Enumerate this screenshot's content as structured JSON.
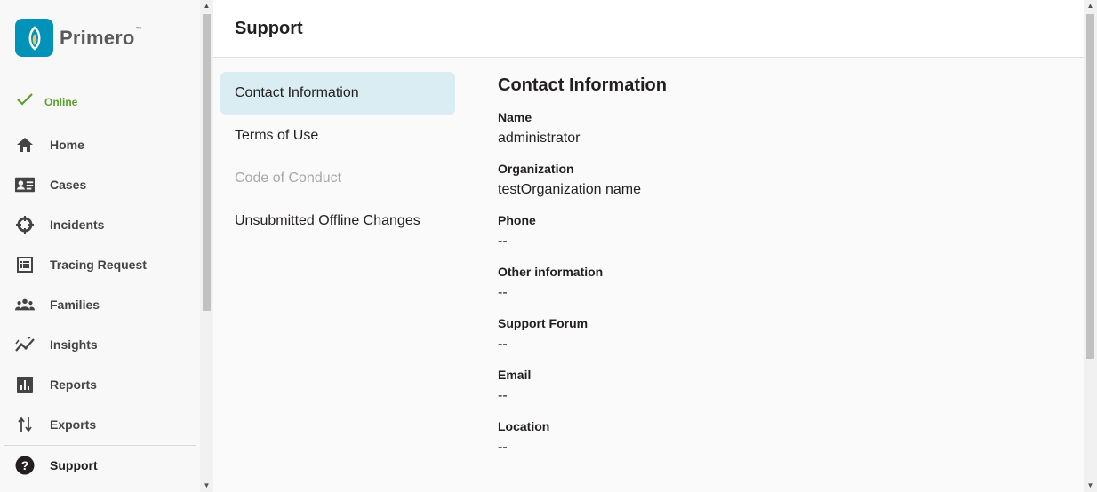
{
  "app": {
    "name": "Primero",
    "trademark": "™"
  },
  "status": {
    "label": "Online",
    "color": "#5aa02c"
  },
  "sidebar": {
    "items": [
      {
        "label": "Home",
        "icon": "home-icon"
      },
      {
        "label": "Cases",
        "icon": "id-card-icon"
      },
      {
        "label": "Incidents",
        "icon": "crosshair-icon"
      },
      {
        "label": "Tracing Request",
        "icon": "list-icon"
      },
      {
        "label": "Families",
        "icon": "people-icon"
      },
      {
        "label": "Insights",
        "icon": "trend-icon"
      },
      {
        "label": "Reports",
        "icon": "bar-chart-icon"
      },
      {
        "label": "Exports",
        "icon": "swap-vertical-icon"
      }
    ],
    "support": {
      "label": "Support",
      "icon": "help-circle-icon"
    }
  },
  "header": {
    "title": "Support"
  },
  "menu": {
    "items": [
      {
        "label": "Contact Information",
        "state": "active"
      },
      {
        "label": "Terms of Use",
        "state": "normal"
      },
      {
        "label": "Code of Conduct",
        "state": "disabled"
      },
      {
        "label": "Unsubmitted Offline Changes",
        "state": "normal"
      }
    ]
  },
  "contact": {
    "title": "Contact Information",
    "fields": [
      {
        "label": "Name",
        "value": "administrator"
      },
      {
        "label": "Organization",
        "value": "testOrganization name"
      },
      {
        "label": "Phone",
        "value": "--"
      },
      {
        "label": "Other information",
        "value": "--"
      },
      {
        "label": "Support Forum",
        "value": "--"
      },
      {
        "label": "Email",
        "value": "--"
      },
      {
        "label": "Location",
        "value": "--"
      }
    ]
  },
  "colors": {
    "brand": "#0093ba",
    "active_menu_bg": "#d9edf3"
  }
}
